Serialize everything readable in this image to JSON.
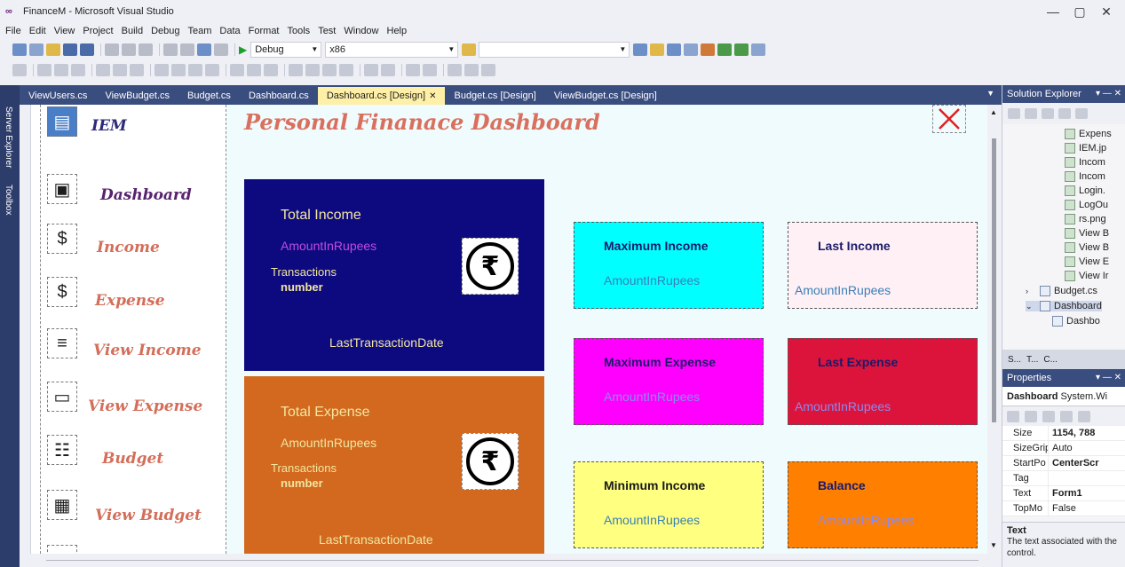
{
  "window": {
    "title": "FinanceM - Microsoft Visual Studio",
    "logo": "∞",
    "minimize": "—",
    "maximize": "▢",
    "close": "✕"
  },
  "menu": [
    "File",
    "Edit",
    "View",
    "Project",
    "Build",
    "Debug",
    "Team",
    "Data",
    "Format",
    "Tools",
    "Test",
    "Window",
    "Help"
  ],
  "toolbar": {
    "config": "Debug",
    "platform": "x86",
    "search": ""
  },
  "left_strip": {
    "server_explorer": "Server Explorer",
    "toolbox": "Toolbox"
  },
  "tabs": [
    {
      "label": "ViewUsers.cs"
    },
    {
      "label": "ViewBudget.cs"
    },
    {
      "label": "Budget.cs"
    },
    {
      "label": "Dashboard.cs"
    },
    {
      "label": "Dashboard.cs [Design]",
      "active": true
    },
    {
      "label": "Budget.cs [Design]"
    },
    {
      "label": "ViewBudget.cs [Design]"
    }
  ],
  "tab_close": "✕",
  "tab_dropdown": "▼",
  "form": {
    "title": "Personal Finanace Dashboard",
    "close_symbol": "✕",
    "nav": [
      {
        "label": "IEM",
        "icon": "card-icon",
        "glyph": "▤"
      },
      {
        "label": "Dashboard",
        "icon": "dashboard-icon",
        "glyph": "▣"
      },
      {
        "label": "Income",
        "icon": "money-bag-icon",
        "glyph": "$"
      },
      {
        "label": "Expense",
        "icon": "dollar-coin-icon",
        "glyph": "$"
      },
      {
        "label": "View Income",
        "icon": "chart-icon",
        "glyph": "≡"
      },
      {
        "label": "View Expense",
        "icon": "wallet-icon",
        "glyph": "▭"
      },
      {
        "label": "Budget",
        "icon": "document-icon",
        "glyph": "☷"
      },
      {
        "label": "View Budget",
        "icon": "calculator-icon",
        "glyph": "▦"
      }
    ],
    "income_panel": {
      "title": "Total Income",
      "amount": "AmountInRupees",
      "transactions_label": "Transactions",
      "number": "number",
      "last_date": "LastTransactionDate",
      "rupee": "₹"
    },
    "expense_panel": {
      "title": "Total Expense",
      "amount": "AmountInRupees",
      "transactions_label": "Transactions",
      "number": "number",
      "last_date": "LastTransactionDate",
      "rupee": "₹"
    },
    "cards": {
      "max_income": {
        "title": "Maximum Income",
        "amount": "AmountInRupees"
      },
      "last_income": {
        "title": "Last Income",
        "amount": "AmountInRupees"
      },
      "max_expense": {
        "title": "Maximum Expense",
        "amount": "AmountInRupees"
      },
      "last_expense": {
        "title": "Last Expense",
        "amount": "AmountInRupees"
      },
      "min_income": {
        "title": "Minimum Income",
        "amount": "AmountInRupees"
      },
      "balance": {
        "title": "Balance",
        "amount": "AmountInRupees"
      }
    }
  },
  "solution_explorer": {
    "title": "Solution Explorer",
    "controls": "▾ ― ✕",
    "files": [
      "Expens",
      "IEM.jp",
      "Incom",
      "Incom",
      "Login.",
      "LogOu",
      "rs.png",
      "View B",
      "View B",
      "View E",
      "View Ir"
    ],
    "budget_cs": "Budget.cs",
    "dashboard_cs": "Dashboard",
    "dashboard_child": "Dashbo",
    "bottom_tabs": [
      "S...",
      "T...",
      "C..."
    ]
  },
  "properties": {
    "title": "Properties",
    "controls": "▾ ― ✕",
    "object": "Dashboard",
    "object_type": "System.Wi",
    "rows": [
      {
        "name": "Size",
        "value": "1154, 788",
        "bold": true
      },
      {
        "name": "SizeGrip",
        "value": "Auto",
        "bold": false
      },
      {
        "name": "StartPo",
        "value": "CenterScr",
        "bold": true
      },
      {
        "name": "Tag",
        "value": "",
        "bold": false
      },
      {
        "name": "Text",
        "value": "Form1",
        "bold": true
      },
      {
        "name": "TopMo",
        "value": "False",
        "bold": false
      }
    ],
    "desc_title": "Text",
    "desc_text": "The text associated with the control."
  },
  "colors": {
    "income_bg": "#0d0a7f",
    "expense_bg": "#d2691e",
    "max_income_bg": "#00ffff",
    "last_income_bg": "#fff0f5",
    "max_expense_bg": "#ff00ff",
    "last_expense_bg": "#dc143c",
    "min_income_bg": "#ffff80",
    "balance_bg": "#ff8000"
  }
}
